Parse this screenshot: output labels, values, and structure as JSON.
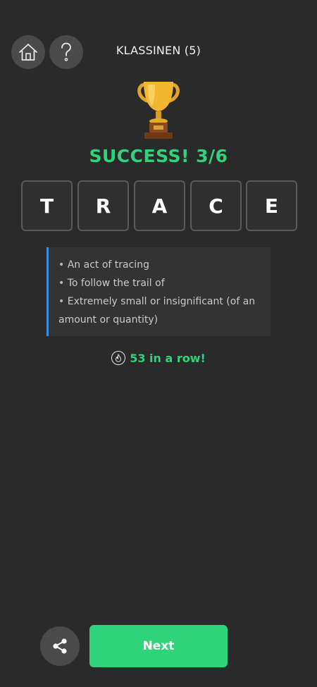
{
  "header": {
    "home_icon": "home-icon",
    "help_icon": "question-mark-icon",
    "mode_title": "KLASSINEN (5)"
  },
  "result": {
    "trophy_icon": "trophy-icon",
    "title": "SUCCESS! 3/6",
    "word_letters": [
      "T",
      "R",
      "A",
      "C",
      "E"
    ]
  },
  "definitions": {
    "items": [
      "An act of tracing",
      "To follow the trail of",
      "Extremely small or insignificant (of an amount or quantity)"
    ]
  },
  "streak": {
    "icon": "flame-icon",
    "text": "53 in a row!"
  },
  "footer": {
    "share_icon": "share-icon",
    "next_label": "Next"
  },
  "colors": {
    "background": "#2a2a2a",
    "accent_green": "#2fd37a",
    "definition_border": "#3a8ee6",
    "button_gray": "#4a4a4a"
  }
}
